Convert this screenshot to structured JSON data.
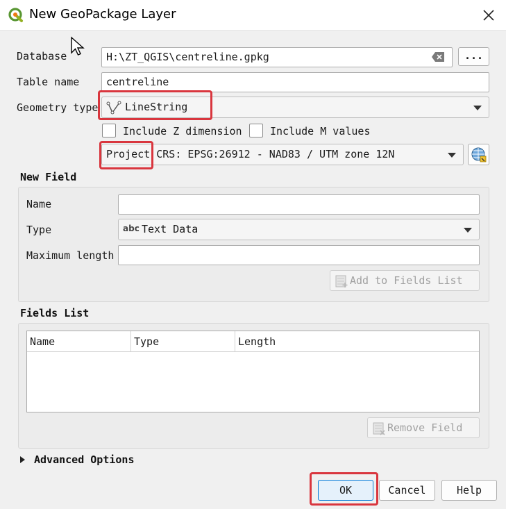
{
  "window": {
    "title": "New GeoPackage Layer",
    "close_icon": "close-icon",
    "app_icon": "qgis-logo-icon"
  },
  "form": {
    "database_label": "Database",
    "database_value": "H:\\ZT_QGIS\\centreline.gpkg",
    "browse_label": "...",
    "table_name_label": "Table name",
    "table_name_value": "centreline",
    "geometry_type_label": "Geometry type",
    "geometry_type_value": "LineString",
    "include_z_label": "Include Z dimension",
    "include_m_label": "Include M values",
    "crs_value": "Project CRS: EPSG:26912 - NAD83 / UTM zone 12N"
  },
  "new_field": {
    "title": "New Field",
    "name_label": "Name",
    "name_value": "",
    "type_label": "Type",
    "type_abbr": "abc",
    "type_value": "Text Data",
    "max_length_label": "Maximum length",
    "max_length_value": "",
    "add_button": "Add to Fields List"
  },
  "fields_list": {
    "title": "Fields List",
    "columns": [
      "Name",
      "Type",
      "Length"
    ],
    "rows": [],
    "remove_button": "Remove Field"
  },
  "advanced": {
    "label": "Advanced Options"
  },
  "buttons": {
    "ok": "OK",
    "cancel": "Cancel",
    "help": "Help"
  },
  "colors": {
    "highlight": "#d9363e",
    "ok_border": "#0078d7"
  }
}
